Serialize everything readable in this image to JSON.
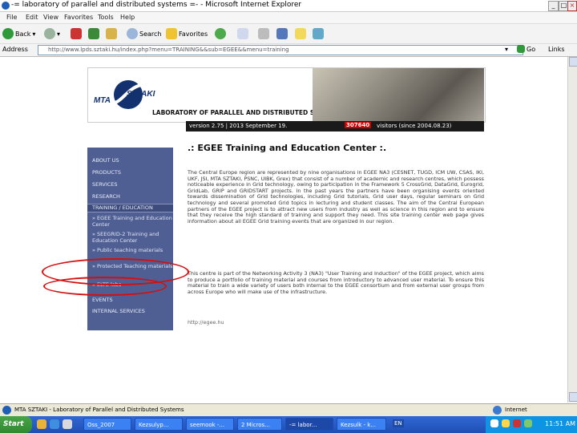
{
  "window": {
    "title": "-= laboratory of parallel and distributed systems =- - Microsoft Internet Explorer"
  },
  "menu": [
    "File",
    "Edit",
    "View",
    "Favorites",
    "Tools",
    "Help"
  ],
  "toolbar": {
    "back": "Back",
    "search": "Search",
    "favorites": "Favorites"
  },
  "address": {
    "label": "Address",
    "url": "http://www.lpds.sztaki.hu/index.php?menu=TRAINING&&sub=EGEE&&menu=training",
    "go": "Go",
    "links": "Links"
  },
  "site": {
    "logo_left": "MTA",
    "logo_right": "SZTAKI",
    "lab_title": "LABORATORY OF PARALLEL AND DISTRIBUTED SYSTEMS",
    "version": "version 2.75 | 2013 September 19.",
    "counter": "307640",
    "visitors": "visitors (since 2004.08.23)",
    "page_title": ".: EGEE Training and Education Center :.",
    "para1": "The Central Europe region are represented by nine organisations in EGEE NA3 (CESNET, TUGD, ICM UW, CSAS, IKI, UKF, JSI, MTA SZTAKI, PSNC, UIBK, Grex) that consist of a number of academic and research centres, which possess noticeable experience in Grid technology, owing to participation in the Framework 5 CrossGrid, DataGrid, Eurogrid, GridLab, GRIP and GRIDSTART projects. In the past years the partners have been organising events oriented towards dissemination of Grid technologies, including Grid tutorials, Grid user days, regular seminars on Grid technology and several promoted Grid topics in lecturing and student classes. The aim of the Central European partners of the EGEE project is to attract new users from industry as well as science in this region and to ensure that they receive the high standard of training and support they need. This site training center web page gives information about all EGEE Grid training events that are organized in our region.",
    "para2": "This centre is part of the Networking Activity 3 (NA3) \"User Training and Induction\" of the EGEE project, which aims to produce a portfolio of training material and courses from introductory to advanced user material. To ensure this material to train a wide variety of users both internal to the EGEE consortium and from external user groups from across Europe who will make use of the infrastructure.",
    "link": "http://egee.hu"
  },
  "sidebar": {
    "items": [
      {
        "label": "ABOUT US"
      },
      {
        "label": "PRODUCTS"
      },
      {
        "label": "SERVICES"
      },
      {
        "label": "RESEARCH"
      },
      {
        "label": "TRAINING / EDUCATION"
      }
    ],
    "sub": [
      "» EGEE Training and Education Center",
      "» SEEGRID-2 Training and Education Center",
      "» Public teaching materials",
      "» Protected Teaching materials",
      "» ELTE labs"
    ],
    "bottom": [
      "EVENTS",
      "INTERNAL SERVICES"
    ]
  },
  "status": {
    "left": "MTA SZTAKI - Laboratory of Parallel and Distributed Systems",
    "zone": "Internet"
  },
  "taskbar": {
    "start": "Start",
    "tasks": [
      "Oss_2007",
      "Kezsulyp...",
      "seemook -...",
      "2 Micros...",
      "-= labor...",
      "Kezsulk - k..."
    ],
    "lang": "EN",
    "clock": "11:51 AM"
  },
  "colors": {
    "sidebar": "#4f5f93",
    "highlight_ring": "#d40f0f",
    "taskbar": "#245edb"
  }
}
